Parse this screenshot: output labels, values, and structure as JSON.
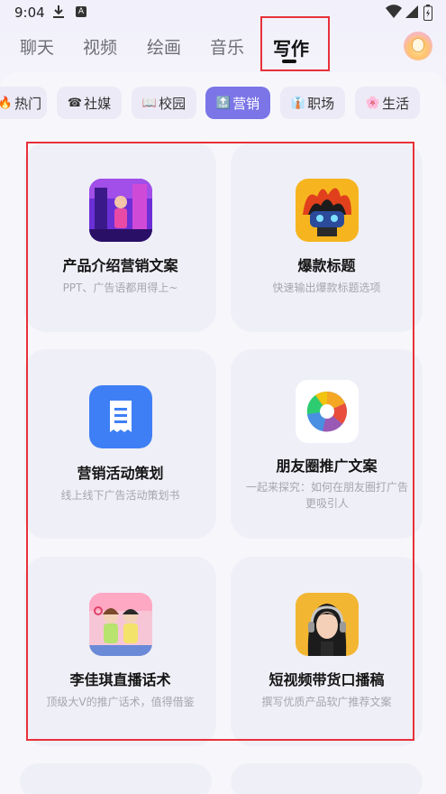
{
  "status_bar": {
    "time": "9:04",
    "a_label": "A"
  },
  "top_tabs": [
    {
      "label": "聊天"
    },
    {
      "label": "视频"
    },
    {
      "label": "绘画"
    },
    {
      "label": "音乐"
    },
    {
      "label": "写作",
      "active": true
    }
  ],
  "chips": [
    {
      "emoji": "🔥",
      "label": "热门"
    },
    {
      "emoji": "☎",
      "label": "社媒"
    },
    {
      "emoji": "📖",
      "label": "校园"
    },
    {
      "emoji": "🔝",
      "label": "营销",
      "active": true
    },
    {
      "emoji": "👔",
      "label": "职场"
    },
    {
      "emoji": "🌸",
      "label": "生活"
    }
  ],
  "cards": [
    {
      "title": "产品介绍营销文案",
      "desc": "PPT、广告语都用得上~",
      "icon": "purple-illustration-icon"
    },
    {
      "title": "爆款标题",
      "desc": "快速输出爆款标题选项",
      "icon": "robot-fire-icon"
    },
    {
      "title": "营销活动策划",
      "desc": "线上线下广告活动策划书",
      "icon": "document-receipt-icon"
    },
    {
      "title": "朋友圈推广文案",
      "desc": "一起来探究：如何在朋友圈打广告更吸引人",
      "icon": "aperture-icon"
    },
    {
      "title": "李佳琪直播话术",
      "desc": "顶级大V的推广话术，值得借鉴",
      "icon": "livestream-duo-icon"
    },
    {
      "title": "短视频带货口播稿",
      "desc": "撰写优质产品软广推荐文案",
      "icon": "girl-headphones-icon"
    }
  ],
  "colors": {
    "accent": "#7b75e8",
    "highlight": "#e8313a"
  }
}
